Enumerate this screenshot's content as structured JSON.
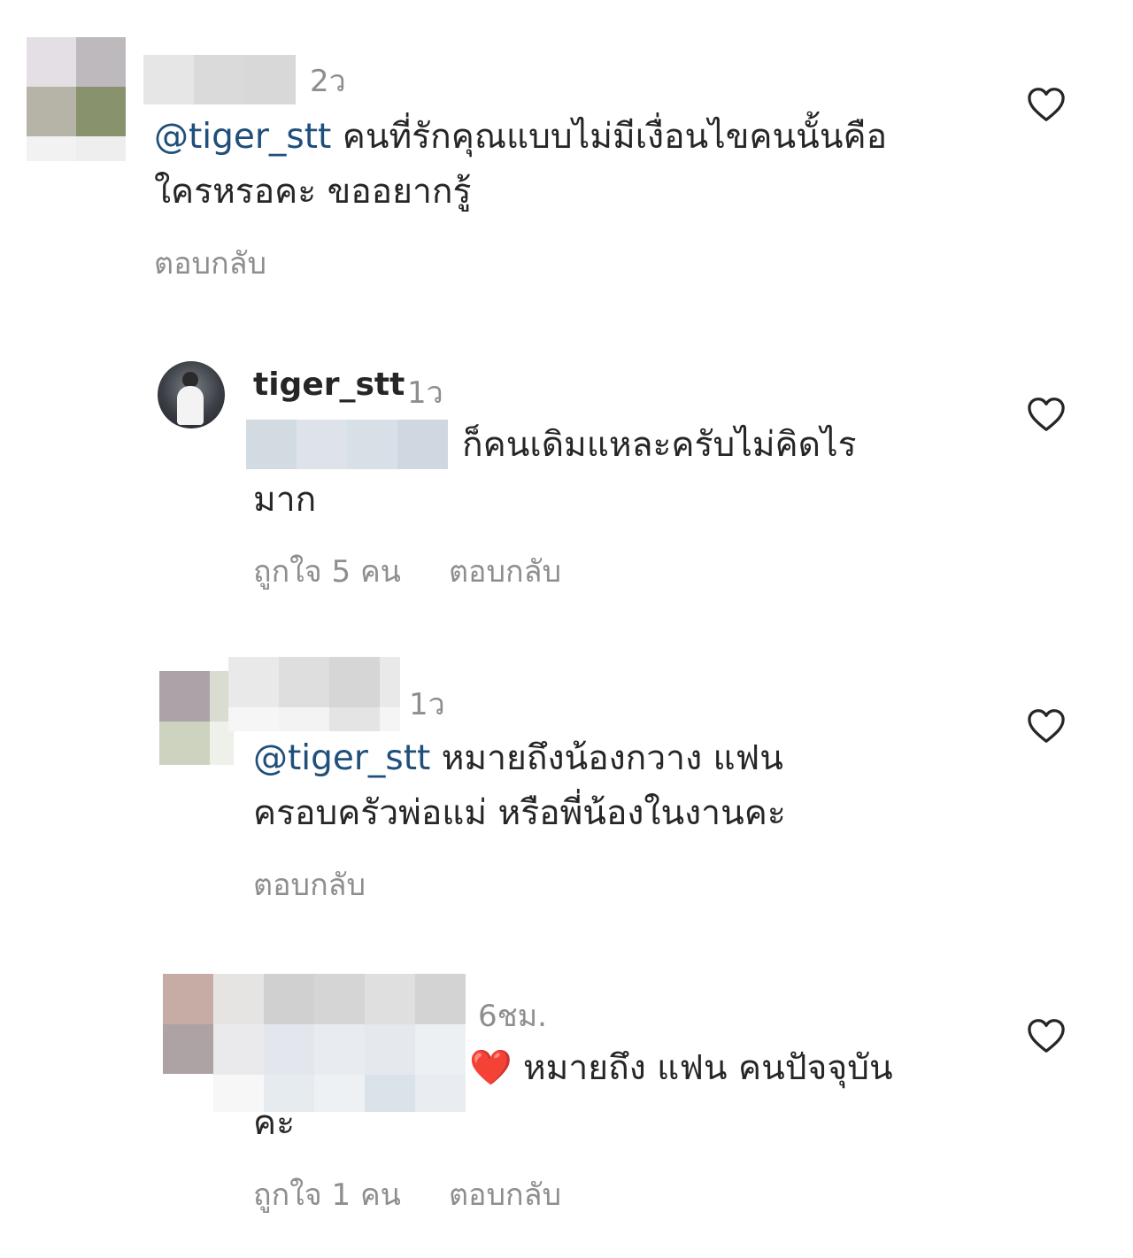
{
  "comments": [
    {
      "time": "2ว",
      "mention": "@tiger_stt",
      "text_line1": " คนที่รักคุณแบบไม่มีเงื่อนไขคนนั้นคือ",
      "text_line2": "ใครหรอคะ ขออยากรู้",
      "reply_label": "ตอบกลับ",
      "like_icon": "heart-outline-icon"
    },
    {
      "username": "tiger_stt",
      "time": "1ว",
      "text_line1": "ก็คนเดิมแหละครับไม่คิดไร",
      "text_line2": "มาก",
      "likes_label": "ถูกใจ 5 คน",
      "reply_label": "ตอบกลับ",
      "like_icon": "heart-outline-icon"
    },
    {
      "time": "1ว",
      "mention": "@tiger_stt",
      "text_line1": " หมายถึงน้องกวาง แฟน",
      "text_line2": "ครอบครัวพ่อแม่ หรือพี่น้องในงานคะ",
      "reply_label": "ตอบกลับ",
      "like_icon": "heart-outline-icon"
    },
    {
      "time": "6ชม.",
      "emoji": "❤️",
      "text_line1": " หมายถึง  แฟน คนปัจจุบัน",
      "text_line2": "คะ",
      "likes_label": "ถูกใจ 1 คน",
      "reply_label": "ตอบกลับ",
      "like_icon": "heart-outline-icon"
    }
  ],
  "colors": {
    "text": "#262626",
    "meta": "#8e8e8e",
    "mention": "#1f4f7a",
    "emoji_heart": "#e0141e"
  }
}
